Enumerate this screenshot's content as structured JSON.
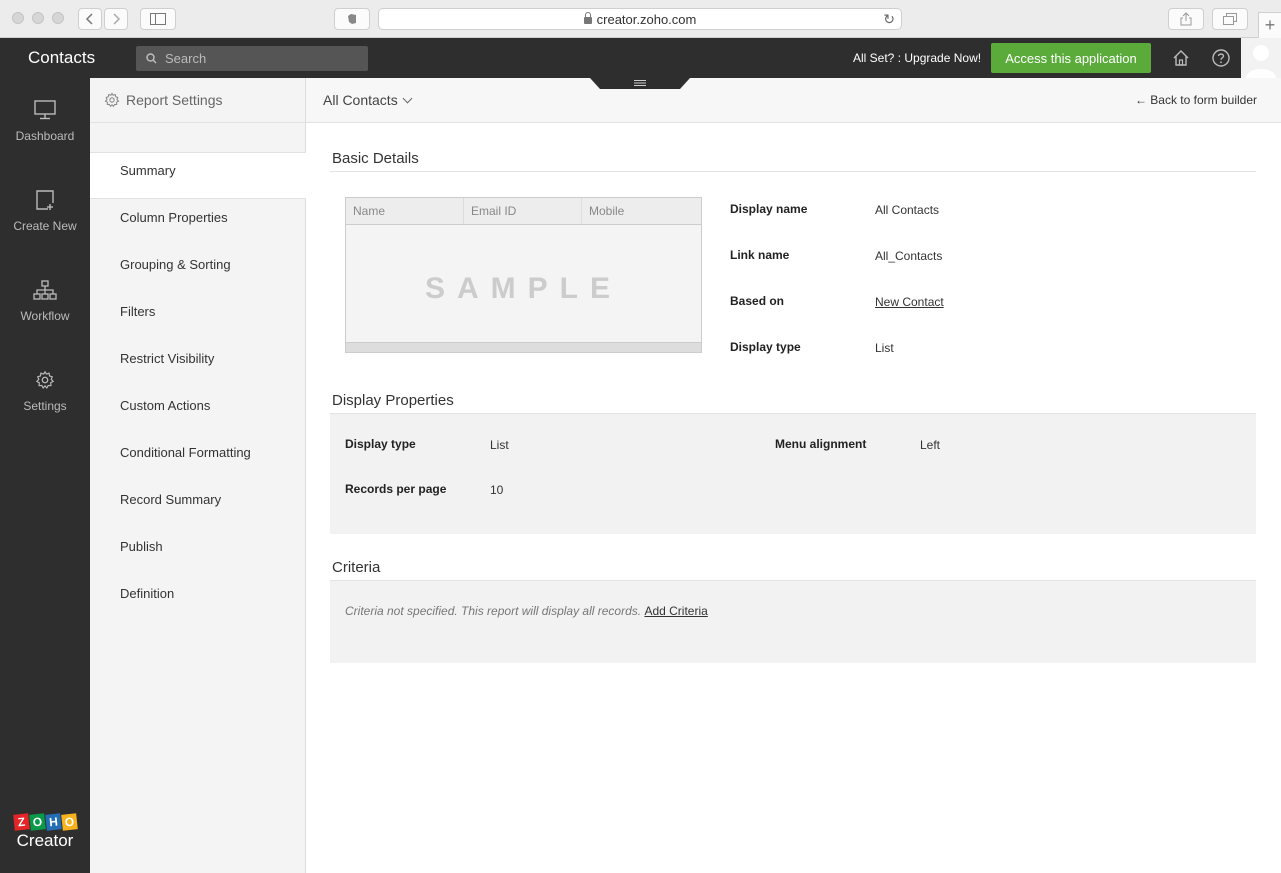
{
  "browser": {
    "url": "creator.zoho.com"
  },
  "topbar": {
    "app_title": "Contacts",
    "search_placeholder": "Search",
    "upgrade_text": "All Set? : Upgrade Now!",
    "access_button": "Access this application"
  },
  "rail": {
    "items": [
      {
        "label": "Dashboard",
        "icon": "monitor-icon"
      },
      {
        "label": "Create New",
        "icon": "add-page-icon"
      },
      {
        "label": "Workflow",
        "icon": "workflow-icon"
      },
      {
        "label": "Settings",
        "icon": "gear-icon"
      }
    ],
    "logo_letters": [
      "Z",
      "O",
      "H",
      "O"
    ],
    "logo_text": "Creator"
  },
  "settings": {
    "title": "Report Settings",
    "menu": [
      "Summary",
      "Column Properties",
      "Grouping & Sorting",
      "Filters",
      "Restrict Visibility",
      "Custom Actions",
      "Conditional Formatting",
      "Record Summary",
      "Publish",
      "Definition"
    ],
    "active": "Summary"
  },
  "header": {
    "report_name": "All Contacts",
    "back_link": "← Back to form builder"
  },
  "basic_details": {
    "title": "Basic Details",
    "sample_columns": [
      "Name",
      "Email ID",
      "Mobile"
    ],
    "sample_label": "SAMPLE",
    "fields": [
      {
        "label": "Display name",
        "value": "All Contacts"
      },
      {
        "label": "Link name",
        "value": "All_Contacts"
      },
      {
        "label": "Based on",
        "value": "New Contact"
      },
      {
        "label": "Display type",
        "value": "List"
      }
    ]
  },
  "display_properties": {
    "title": "Display Properties",
    "display_type_label": "Display type",
    "display_type_value": "List",
    "menu_alignment_label": "Menu alignment",
    "menu_alignment_value": "Left",
    "records_per_page_label": "Records per page",
    "records_per_page_value": "10"
  },
  "criteria": {
    "title": "Criteria",
    "message": "Criteria not specified. This report will display all records.",
    "add_link": "Add Criteria"
  },
  "colors": {
    "accent_green": "#5bab3b",
    "dark_bar": "#2e2e2e"
  }
}
